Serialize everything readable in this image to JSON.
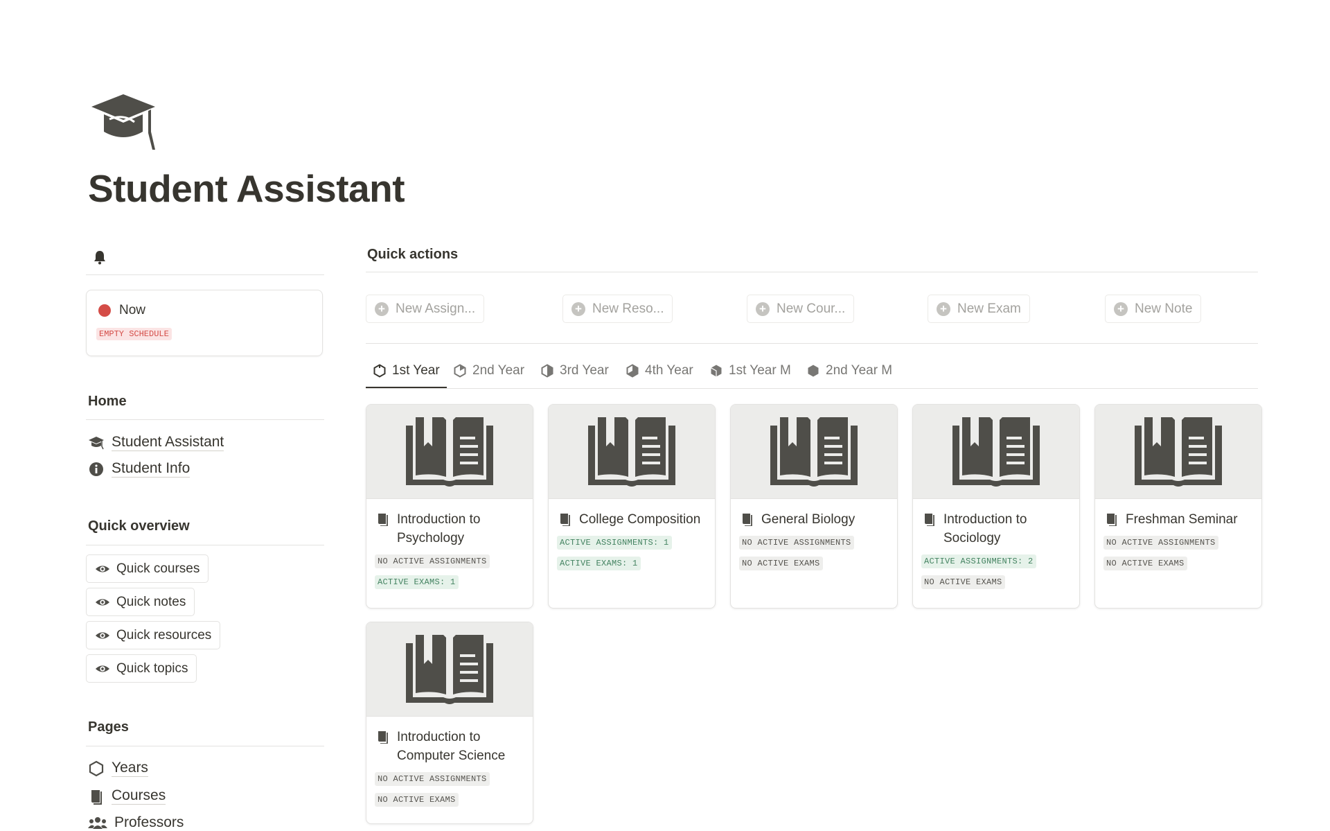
{
  "page": {
    "title": "Student Assistant"
  },
  "sidebar": {
    "now": {
      "label": "Now",
      "badge": "EMPTY SCHEDULE"
    },
    "home": {
      "title": "Home",
      "links": [
        {
          "label": "Student Assistant",
          "icon": "graduation-cap-icon"
        },
        {
          "label": "Student Info",
          "icon": "info-icon"
        }
      ]
    },
    "overview": {
      "title": "Quick overview",
      "buttons": [
        "Quick courses",
        "Quick notes",
        "Quick resources",
        "Quick topics"
      ]
    },
    "pages": {
      "title": "Pages",
      "links": [
        {
          "label": "Years",
          "icon": "hexagon-icon"
        },
        {
          "label": "Courses",
          "icon": "book-icon"
        },
        {
          "label": "Professors",
          "icon": "people-icon"
        }
      ]
    }
  },
  "main": {
    "quick_actions_title": "Quick actions",
    "actions": [
      "New Assign...",
      "New Reso...",
      "New Cour...",
      "New Exam",
      "New Note"
    ],
    "tabs": [
      "1st Year",
      "2nd Year",
      "3rd Year",
      "4th Year",
      "1st Year M",
      "2nd Year M"
    ],
    "active_tab": "1st Year",
    "courses": [
      {
        "title": "Introduction to Psychology",
        "assignments": "NO ACTIVE ASSIGNMENTS",
        "exams": "ACTIVE EXAMS: 1"
      },
      {
        "title": "College Composition",
        "assignments": "ACTIVE ASSIGNMENTS: 1",
        "exams": "ACTIVE EXAMS: 1"
      },
      {
        "title": "General Biology",
        "assignments": "NO ACTIVE ASSIGNMENTS",
        "exams": "NO ACTIVE EXAMS"
      },
      {
        "title": "Introduction to Sociology",
        "assignments": "ACTIVE ASSIGNMENTS: 2",
        "exams": "NO ACTIVE EXAMS"
      },
      {
        "title": "Freshman Seminar",
        "assignments": "NO ACTIVE ASSIGNMENTS",
        "exams": "NO ACTIVE EXAMS"
      },
      {
        "title": "Introduction to Computer Science",
        "assignments": "NO ACTIVE ASSIGNMENTS",
        "exams": "NO ACTIVE EXAMS"
      }
    ]
  },
  "colors": {
    "text": "#37352f",
    "red": "#d44c47",
    "green": "#448361"
  }
}
